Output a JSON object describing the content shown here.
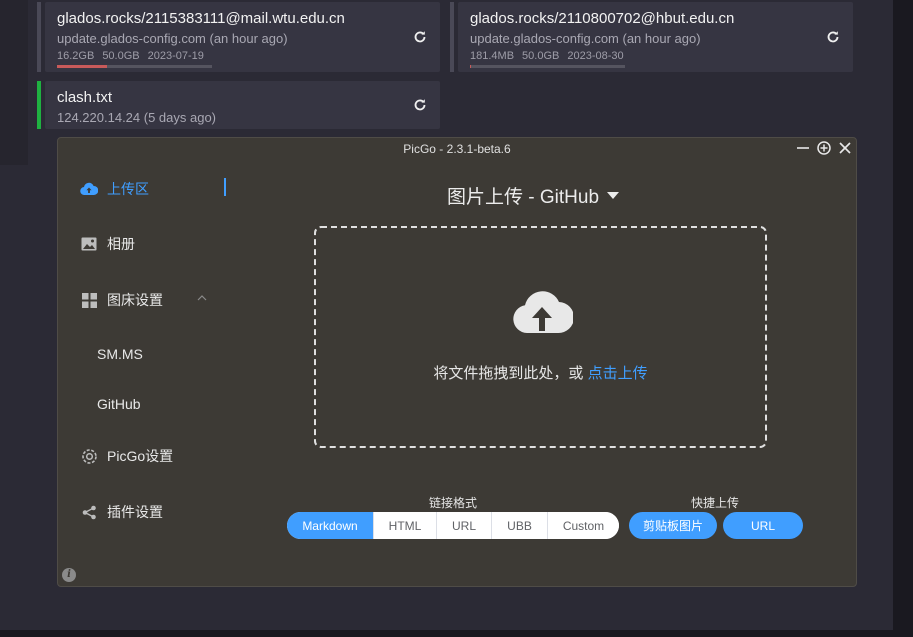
{
  "cards": [
    {
      "title": "glados.rocks/2115383111@mail.wtu.edu.cn",
      "subtitle": "update.glados-config.com (an hour ago)",
      "used": "16.2GB",
      "total": "50.0GB",
      "expiry": "2023-07-19",
      "usage_fraction": 0.32
    },
    {
      "title": "glados.rocks/2110800702@hbut.edu.cn",
      "subtitle": "update.glados-config.com (an hour ago)",
      "used": "181.4MB",
      "total": "50.0GB",
      "expiry": "2023-08-30",
      "usage_fraction": 0.004
    },
    {
      "title": "clash.txt",
      "subtitle": "124.220.14.24 (5 days ago)"
    }
  ],
  "picgo": {
    "window_title": "PicGo - 2.3.1-beta.6",
    "nav": {
      "upload": "上传区",
      "album": "相册",
      "picbed_settings": "图床设置",
      "smms": "SM.MS",
      "github": "GitHub",
      "picgo_settings": "PicGo设置",
      "plugin_settings": "插件设置"
    },
    "upload_title": "图片上传 - GitHub",
    "drop_hint": "将文件拖拽到此处，或 ",
    "drop_link": "点击上传",
    "format_label": "链接格式",
    "formats": [
      "Markdown",
      "HTML",
      "URL",
      "UBB",
      "Custom"
    ],
    "selected_format": "Markdown",
    "quick_upload_label": "快捷上传",
    "quick_buttons": [
      "剪贴板图片",
      "URL"
    ]
  },
  "colors": {
    "accent": "#409eff",
    "active_edge": "#1fb141",
    "usage_bar": "#c85a5a"
  }
}
